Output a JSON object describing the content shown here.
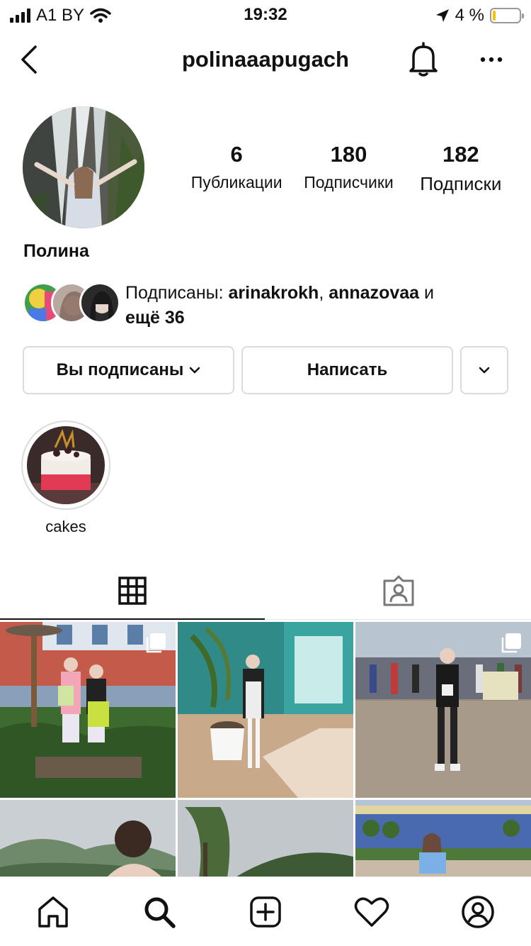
{
  "status_bar": {
    "carrier": "A1 BY",
    "time": "19:32",
    "battery_text": "4 %",
    "battery_level": 0.04
  },
  "header": {
    "username": "polinaaapugach",
    "back_icon": "chevron-left-icon",
    "bell_icon": "bell-icon",
    "more_icon": "more-horizontal-icon"
  },
  "profile": {
    "full_name": "Полина",
    "stats": [
      {
        "value": "6",
        "label": "Публикации"
      },
      {
        "value": "180",
        "label": "Подписчики"
      },
      {
        "value": "182",
        "label": "Подписки"
      }
    ],
    "followed_by": {
      "prefix": "Подписаны: ",
      "user1": "arinakrokh",
      "sep": ", ",
      "user2": "annazovaa",
      "and": " и",
      "more": "ещё 36"
    }
  },
  "buttons": {
    "subscribed": "Вы подписаны",
    "message": "Написать",
    "suggest_icon": "chevron-down-icon"
  },
  "highlights": [
    {
      "label": "cakes"
    }
  ],
  "tabs": {
    "grid_icon": "grid-icon",
    "tagged_icon": "tagged-person-icon"
  },
  "bottom_nav": [
    "home-icon",
    "search-icon",
    "add-post-icon",
    "heart-icon",
    "profile-icon"
  ],
  "colors": {
    "text": "#111111",
    "border": "#dbdbdb",
    "battery_low": "#f4c300"
  }
}
